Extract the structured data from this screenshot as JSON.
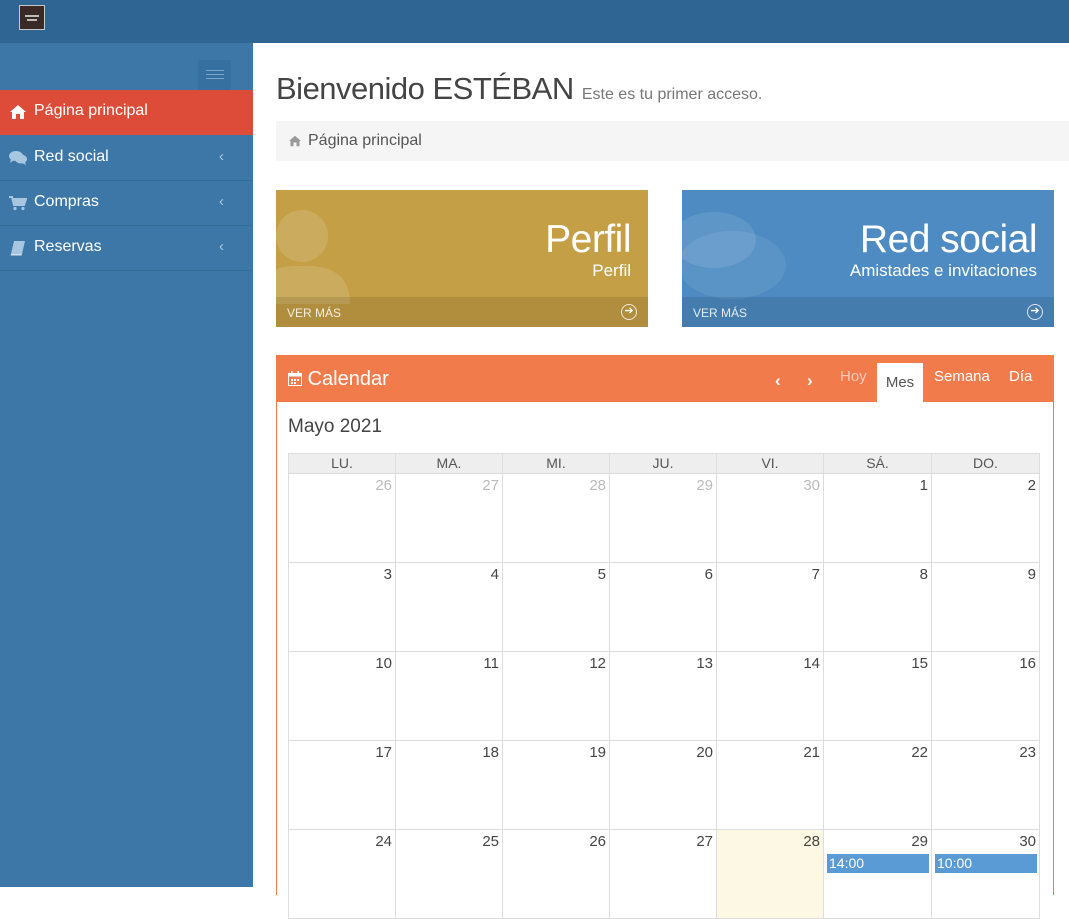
{
  "sidebar": {
    "items": [
      {
        "label": "Página principal",
        "icon": "home-icon",
        "active": true
      },
      {
        "label": "Red social",
        "icon": "comments-icon",
        "chevron": "‹"
      },
      {
        "label": "Compras",
        "icon": "cart-icon",
        "chevron": "‹"
      },
      {
        "label": "Reservas",
        "icon": "book-icon",
        "chevron": "‹"
      }
    ]
  },
  "header": {
    "title": "Bienvenido ESTÉBAN",
    "subtitle": "Este es tu primer acceso."
  },
  "breadcrumb": {
    "label": "Página principal"
  },
  "tiles": [
    {
      "title": "Perfil",
      "subtitle": "Perfil",
      "more": "VER MÁS",
      "color": "#c49f46"
    },
    {
      "title": "Red social",
      "subtitle": "Amistades e invitaciones",
      "more": "VER MÁS",
      "color": "#4d8bc2"
    }
  ],
  "calendar": {
    "title": "Calendar",
    "buttons": {
      "prev": "‹",
      "next": "›",
      "today": "Hoy",
      "month": "Mes",
      "week": "Semana",
      "day": "Día"
    },
    "month_label": "Mayo 2021",
    "day_headers": [
      "LU.",
      "MA.",
      "MI.",
      "JU.",
      "VI.",
      "SÁ.",
      "DO."
    ],
    "weeks": [
      [
        "26",
        "27",
        "28",
        "29",
        "30",
        "1",
        "2"
      ],
      [
        "3",
        "4",
        "5",
        "6",
        "7",
        "8",
        "9"
      ],
      [
        "10",
        "11",
        "12",
        "13",
        "14",
        "15",
        "16"
      ],
      [
        "17",
        "18",
        "19",
        "20",
        "21",
        "22",
        "23"
      ],
      [
        "24",
        "25",
        "26",
        "27",
        "28",
        "29",
        "30"
      ]
    ],
    "events": {
      "sat29": "14:00",
      "sun30": "10:00"
    },
    "colors": {
      "header": "#f27b4b",
      "today": "#fcf8e3",
      "event": "#5b9bd5"
    }
  },
  "colors": {
    "topbar": "#2f6592",
    "sidebar": "#3d77a8",
    "active": "#dd4b39"
  }
}
